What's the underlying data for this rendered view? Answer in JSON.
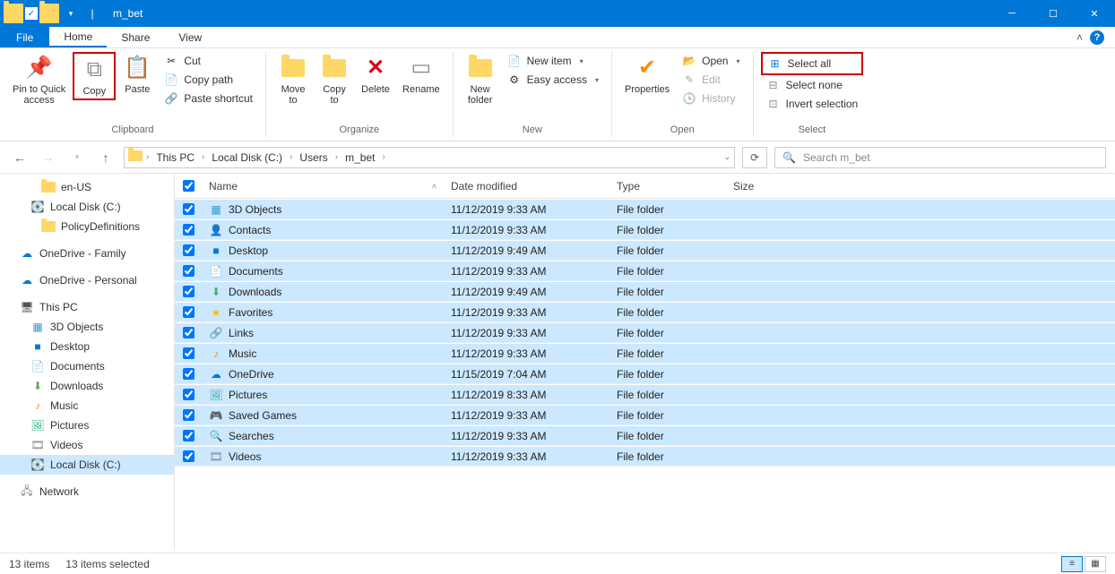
{
  "window": {
    "title": "m_bet"
  },
  "tabs": {
    "file": "File",
    "home": "Home",
    "share": "Share",
    "view": "View"
  },
  "ribbon": {
    "clipboard": {
      "label": "Clipboard",
      "pin": "Pin to Quick\naccess",
      "copy": "Copy",
      "paste": "Paste",
      "cut": "Cut",
      "copy_path": "Copy path",
      "paste_shortcut": "Paste shortcut"
    },
    "organize": {
      "label": "Organize",
      "move_to": "Move\nto",
      "copy_to": "Copy\nto",
      "delete": "Delete",
      "rename": "Rename"
    },
    "new": {
      "label": "New",
      "new_folder": "New\nfolder",
      "new_item": "New item",
      "easy_access": "Easy access"
    },
    "open": {
      "label": "Open",
      "properties": "Properties",
      "open": "Open",
      "edit": "Edit",
      "history": "History"
    },
    "select": {
      "label": "Select",
      "select_all": "Select all",
      "select_none": "Select none",
      "invert": "Invert selection"
    }
  },
  "address": {
    "crumbs": [
      "This PC",
      "Local Disk (C:)",
      "Users",
      "m_bet"
    ]
  },
  "search": {
    "placeholder": "Search m_bet"
  },
  "sidebar": {
    "items": [
      {
        "label": "en-US",
        "icon": "folder",
        "indent": 2
      },
      {
        "label": "Local Disk (C:)",
        "icon": "drive",
        "indent": 1
      },
      {
        "label": "PolicyDefinitions",
        "icon": "folder",
        "indent": 2
      },
      {
        "gap": true
      },
      {
        "label": "OneDrive - Family",
        "icon": "cloud",
        "indent": 0
      },
      {
        "gap": true
      },
      {
        "label": "OneDrive - Personal",
        "icon": "cloud",
        "indent": 0
      },
      {
        "gap": true
      },
      {
        "label": "This PC",
        "icon": "monitor",
        "indent": 0,
        "expanded": true
      },
      {
        "label": "3D Objects",
        "icon": "3d",
        "indent": 1
      },
      {
        "label": "Desktop",
        "icon": "desktop",
        "indent": 1
      },
      {
        "label": "Documents",
        "icon": "docs",
        "indent": 1
      },
      {
        "label": "Downloads",
        "icon": "downloads",
        "indent": 1
      },
      {
        "label": "Music",
        "icon": "music",
        "indent": 1
      },
      {
        "label": "Pictures",
        "icon": "pictures",
        "indent": 1
      },
      {
        "label": "Videos",
        "icon": "videos",
        "indent": 1
      },
      {
        "label": "Local Disk (C:)",
        "icon": "drive",
        "indent": 1,
        "selected": true
      },
      {
        "gap": true
      },
      {
        "label": "Network",
        "icon": "network",
        "indent": 0
      }
    ]
  },
  "columns": {
    "name": "Name",
    "date": "Date modified",
    "type": "Type",
    "size": "Size"
  },
  "files": [
    {
      "name": "3D Objects",
      "date": "11/12/2019 9:33 AM",
      "type": "File folder",
      "icon": "3d"
    },
    {
      "name": "Contacts",
      "date": "11/12/2019 9:33 AM",
      "type": "File folder",
      "icon": "contacts"
    },
    {
      "name": "Desktop",
      "date": "11/12/2019 9:49 AM",
      "type": "File folder",
      "icon": "desktop"
    },
    {
      "name": "Documents",
      "date": "11/12/2019 9:33 AM",
      "type": "File folder",
      "icon": "docs"
    },
    {
      "name": "Downloads",
      "date": "11/12/2019 9:49 AM",
      "type": "File folder",
      "icon": "downloads"
    },
    {
      "name": "Favorites",
      "date": "11/12/2019 9:33 AM",
      "type": "File folder",
      "icon": "fav"
    },
    {
      "name": "Links",
      "date": "11/12/2019 9:33 AM",
      "type": "File folder",
      "icon": "links"
    },
    {
      "name": "Music",
      "date": "11/12/2019 9:33 AM",
      "type": "File folder",
      "icon": "music"
    },
    {
      "name": "OneDrive",
      "date": "11/15/2019 7:04 AM",
      "type": "File folder",
      "icon": "cloud"
    },
    {
      "name": "Pictures",
      "date": "11/12/2019 8:33 AM",
      "type": "File folder",
      "icon": "pictures"
    },
    {
      "name": "Saved Games",
      "date": "11/12/2019 9:33 AM",
      "type": "File folder",
      "icon": "games"
    },
    {
      "name": "Searches",
      "date": "11/12/2019 9:33 AM",
      "type": "File folder",
      "icon": "search"
    },
    {
      "name": "Videos",
      "date": "11/12/2019 9:33 AM",
      "type": "File folder",
      "icon": "videos"
    }
  ],
  "status": {
    "items": "13 items",
    "selected": "13 items selected"
  }
}
